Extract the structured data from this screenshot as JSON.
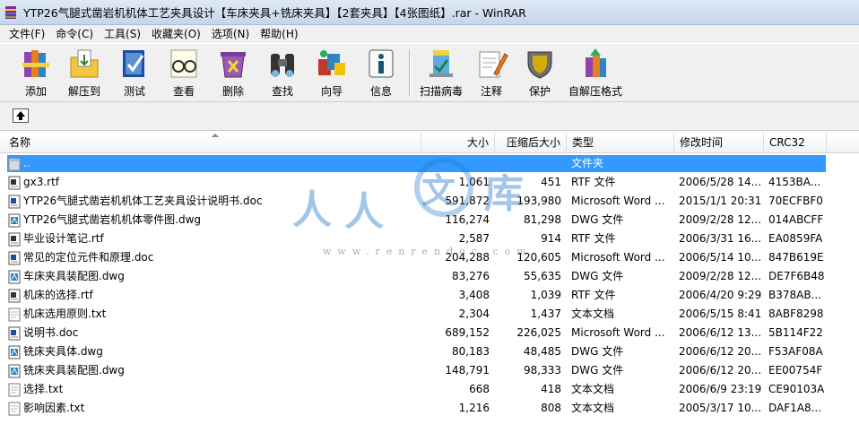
{
  "window": {
    "title": "YTP26气腿式凿岩机机体工艺夹具设计【车床夹具+铣床夹具】【2套夹具】【4张图纸】.rar - WinRAR"
  },
  "menu": [
    "文件(F)",
    "命令(C)",
    "工具(S)",
    "收藏夹(O)",
    "选项(N)",
    "帮助(H)"
  ],
  "toolbar": {
    "add": "添加",
    "extract": "解压到",
    "test": "测试",
    "view": "查看",
    "delete": "删除",
    "find": "查找",
    "wizard": "向导",
    "info": "信息",
    "scan": "扫描病毒",
    "comment": "注释",
    "protect": "保护",
    "sfx": "自解压格式"
  },
  "columns": {
    "name": "名称",
    "size": "大小",
    "packed": "压缩后大小",
    "type": "类型",
    "modified": "修改时间",
    "crc": "CRC32"
  },
  "rows": [
    {
      "name": "..",
      "size": "",
      "packed": "",
      "type": "文件夹",
      "modified": "",
      "crc": "",
      "icon": "folder-up-icon"
    },
    {
      "name": "gx3.rtf",
      "size": "1,061",
      "packed": "451",
      "type": "RTF 文件",
      "modified": "2006/5/28 14...",
      "crc": "4153BA...",
      "icon": "rtf-file-icon"
    },
    {
      "name": "YTP26气腿式凿岩机机体工艺夹具设计说明书.doc",
      "size": "591,872",
      "packed": "193,980",
      "type": "Microsoft Word ...",
      "modified": "2015/1/1 20:31",
      "crc": "70ECFBF0",
      "icon": "doc-file-icon"
    },
    {
      "name": "YTP26气腿式凿岩机机体零件图.dwg",
      "size": "116,274",
      "packed": "81,298",
      "type": "DWG 文件",
      "modified": "2009/2/28 12...",
      "crc": "014ABCFF",
      "icon": "dwg-file-icon"
    },
    {
      "name": "毕业设计笔记.rtf",
      "size": "2,587",
      "packed": "914",
      "type": "RTF 文件",
      "modified": "2006/3/31 16...",
      "crc": "EA0859FA",
      "icon": "rtf-file-icon"
    },
    {
      "name": "常见的定位元件和原理.doc",
      "size": "204,288",
      "packed": "120,605",
      "type": "Microsoft Word ...",
      "modified": "2006/5/14 10...",
      "crc": "847B619E",
      "icon": "doc-file-icon"
    },
    {
      "name": "车床夹具装配图.dwg",
      "size": "83,276",
      "packed": "55,635",
      "type": "DWG 文件",
      "modified": "2009/2/28 12...",
      "crc": "DE7F6B48",
      "icon": "dwg-file-icon"
    },
    {
      "name": "机床的选择.rtf",
      "size": "3,408",
      "packed": "1,039",
      "type": "RTF 文件",
      "modified": "2006/4/20 9:29",
      "crc": "B378AB...",
      "icon": "rtf-file-icon"
    },
    {
      "name": "机床选用原则.txt",
      "size": "2,304",
      "packed": "1,437",
      "type": "文本文档",
      "modified": "2006/5/15 8:41",
      "crc": "8ABF8298",
      "icon": "txt-file-icon"
    },
    {
      "name": "说明书.doc",
      "size": "689,152",
      "packed": "226,025",
      "type": "Microsoft Word ...",
      "modified": "2006/6/12 13...",
      "crc": "5B114F22",
      "icon": "doc-file-icon"
    },
    {
      "name": "铣床夹具体.dwg",
      "size": "80,183",
      "packed": "48,485",
      "type": "DWG 文件",
      "modified": "2006/6/12 20...",
      "crc": "F53AF08A",
      "icon": "dwg-file-icon"
    },
    {
      "name": "铣床夹具装配图.dwg",
      "size": "148,791",
      "packed": "98,333",
      "type": "DWG 文件",
      "modified": "2006/6/12 20...",
      "crc": "EE00754F",
      "icon": "dwg-file-icon"
    },
    {
      "name": "选择.txt",
      "size": "668",
      "packed": "418",
      "type": "文本文档",
      "modified": "2006/6/9 23:19",
      "crc": "CE90103A",
      "icon": "txt-file-icon"
    },
    {
      "name": "影响因素.txt",
      "size": "1,216",
      "packed": "808",
      "type": "文本文档",
      "modified": "2005/3/17 10...",
      "crc": "DAF1A8...",
      "icon": "txt-file-icon"
    }
  ],
  "watermark": {
    "chars": [
      "人",
      "人",
      "文",
      "库"
    ],
    "url": "www.renrendoc.com"
  },
  "colors": {
    "selection": "#3399ff",
    "watermark": "#1e78c8"
  }
}
